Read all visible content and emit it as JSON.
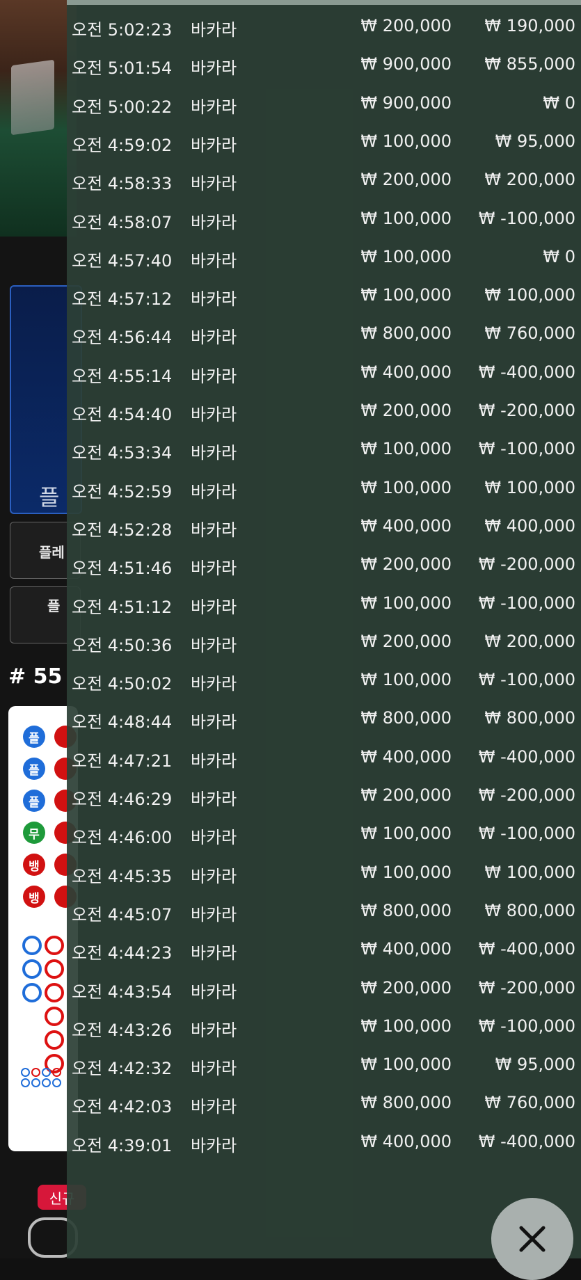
{
  "background": {
    "bet_panel_label": "플",
    "side_buttons": [
      "플레",
      "플"
    ],
    "round": "# 55",
    "road_labels": [
      "플",
      "플",
      "플",
      "무",
      "뱅",
      "뱅"
    ],
    "new_badge": "신규"
  },
  "history": {
    "rows": [
      {
        "time": "오전 5:02:23",
        "game": "바카라",
        "bet": "₩ 200,000",
        "win": "₩ 190,000"
      },
      {
        "time": "오전 5:01:54",
        "game": "바카라",
        "bet": "₩ 900,000",
        "win": "₩ 855,000"
      },
      {
        "time": "오전 5:00:22",
        "game": "바카라",
        "bet": "₩ 900,000",
        "win": "₩ 0"
      },
      {
        "time": "오전 4:59:02",
        "game": "바카라",
        "bet": "₩ 100,000",
        "win": "₩ 95,000"
      },
      {
        "time": "오전 4:58:33",
        "game": "바카라",
        "bet": "₩ 200,000",
        "win": "₩ 200,000"
      },
      {
        "time": "오전 4:58:07",
        "game": "바카라",
        "bet": "₩ 100,000",
        "win": "₩ -100,000"
      },
      {
        "time": "오전 4:57:40",
        "game": "바카라",
        "bet": "₩ 100,000",
        "win": "₩ 0"
      },
      {
        "time": "오전 4:57:12",
        "game": "바카라",
        "bet": "₩ 100,000",
        "win": "₩ 100,000"
      },
      {
        "time": "오전 4:56:44",
        "game": "바카라",
        "bet": "₩ 800,000",
        "win": "₩ 760,000"
      },
      {
        "time": "오전 4:55:14",
        "game": "바카라",
        "bet": "₩ 400,000",
        "win": "₩ -400,000"
      },
      {
        "time": "오전 4:54:40",
        "game": "바카라",
        "bet": "₩ 200,000",
        "win": "₩ -200,000"
      },
      {
        "time": "오전 4:53:34",
        "game": "바카라",
        "bet": "₩ 100,000",
        "win": "₩ -100,000"
      },
      {
        "time": "오전 4:52:59",
        "game": "바카라",
        "bet": "₩ 100,000",
        "win": "₩ 100,000"
      },
      {
        "time": "오전 4:52:28",
        "game": "바카라",
        "bet": "₩ 400,000",
        "win": "₩ 400,000"
      },
      {
        "time": "오전 4:51:46",
        "game": "바카라",
        "bet": "₩ 200,000",
        "win": "₩ -200,000"
      },
      {
        "time": "오전 4:51:12",
        "game": "바카라",
        "bet": "₩ 100,000",
        "win": "₩ -100,000"
      },
      {
        "time": "오전 4:50:36",
        "game": "바카라",
        "bet": "₩ 200,000",
        "win": "₩ 200,000"
      },
      {
        "time": "오전 4:50:02",
        "game": "바카라",
        "bet": "₩ 100,000",
        "win": "₩ -100,000"
      },
      {
        "time": "오전 4:48:44",
        "game": "바카라",
        "bet": "₩ 800,000",
        "win": "₩ 800,000"
      },
      {
        "time": "오전 4:47:21",
        "game": "바카라",
        "bet": "₩ 400,000",
        "win": "₩ -400,000"
      },
      {
        "time": "오전 4:46:29",
        "game": "바카라",
        "bet": "₩ 200,000",
        "win": "₩ -200,000"
      },
      {
        "time": "오전 4:46:00",
        "game": "바카라",
        "bet": "₩ 100,000",
        "win": "₩ -100,000"
      },
      {
        "time": "오전 4:45:35",
        "game": "바카라",
        "bet": "₩ 100,000",
        "win": "₩ 100,000"
      },
      {
        "time": "오전 4:45:07",
        "game": "바카라",
        "bet": "₩ 800,000",
        "win": "₩ 800,000"
      },
      {
        "time": "오전 4:44:23",
        "game": "바카라",
        "bet": "₩ 400,000",
        "win": "₩ -400,000"
      },
      {
        "time": "오전 4:43:54",
        "game": "바카라",
        "bet": "₩ 200,000",
        "win": "₩ -200,000"
      },
      {
        "time": "오전 4:43:26",
        "game": "바카라",
        "bet": "₩ 100,000",
        "win": "₩ -100,000"
      },
      {
        "time": "오전 4:42:32",
        "game": "바카라",
        "bet": "₩ 100,000",
        "win": "₩ 95,000"
      },
      {
        "time": "오전 4:42:03",
        "game": "바카라",
        "bet": "₩ 800,000",
        "win": "₩ 760,000"
      },
      {
        "time": "오전 4:39:01",
        "game": "바카라",
        "bet": "₩ 400,000",
        "win": "₩ -400,000"
      }
    ]
  },
  "close_button": {
    "icon": "close-icon"
  },
  "colors": {
    "overlay": "#2c4036",
    "road_blue": "#1f6dd9",
    "road_red": "#d11111",
    "road_green": "#1e9a3a",
    "badge": "#d7173a"
  }
}
